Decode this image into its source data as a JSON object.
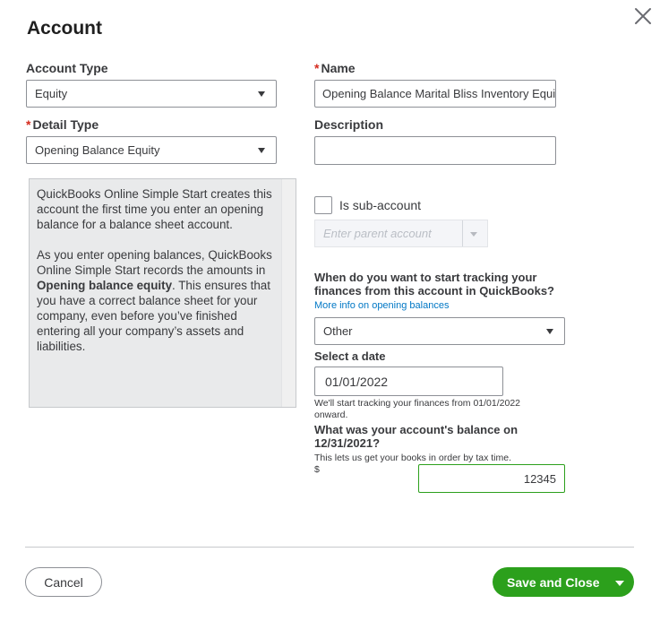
{
  "dialog": {
    "title": "Account",
    "close_icon": "close-icon"
  },
  "account_type": {
    "label": "Account Type",
    "value": "Equity"
  },
  "detail_type": {
    "required_mark": "*",
    "label": "Detail Type",
    "value": "Opening Balance Equity"
  },
  "name": {
    "required_mark": "*",
    "label": "Name",
    "value": "Opening Balance Marital Bliss Inventory Equity"
  },
  "description": {
    "label": "Description",
    "value": ""
  },
  "info": {
    "paragraph1": "QuickBooks Online Simple Start creates this account the first time you enter an opening balance for a balance sheet account.",
    "paragraph2_before": "As you enter opening balances, QuickBooks Online Simple Start records the amounts in ",
    "paragraph2_bold": "Opening balance equity",
    "paragraph2_after": ". This ensures that you have a correct balance sheet for your company, even before you’ve finished entering all your company’s assets and liabilities."
  },
  "sub_account": {
    "label": "Is sub-account",
    "checked": false,
    "parent_placeholder": "Enter parent account"
  },
  "tracking": {
    "question": "When do you want to start tracking your finances from this account in QuickBooks?",
    "more_info_link": "More info on opening balances",
    "option_value": "Other",
    "date_label": "Select a date",
    "date_value": "01/01/2022",
    "date_hint": "We'll start tracking your finances from 01/01/2022 onward."
  },
  "balance": {
    "question": "What was your account's balance on 12/31/2021?",
    "hint": "This lets us get your books in order by tax time.",
    "currency": "$",
    "value": "12345"
  },
  "footer": {
    "cancel_label": "Cancel",
    "save_label": "Save and Close"
  },
  "colors": {
    "primary_green": "#2ca01c",
    "link_blue": "#0077c5",
    "required_red": "#d52b1e"
  }
}
